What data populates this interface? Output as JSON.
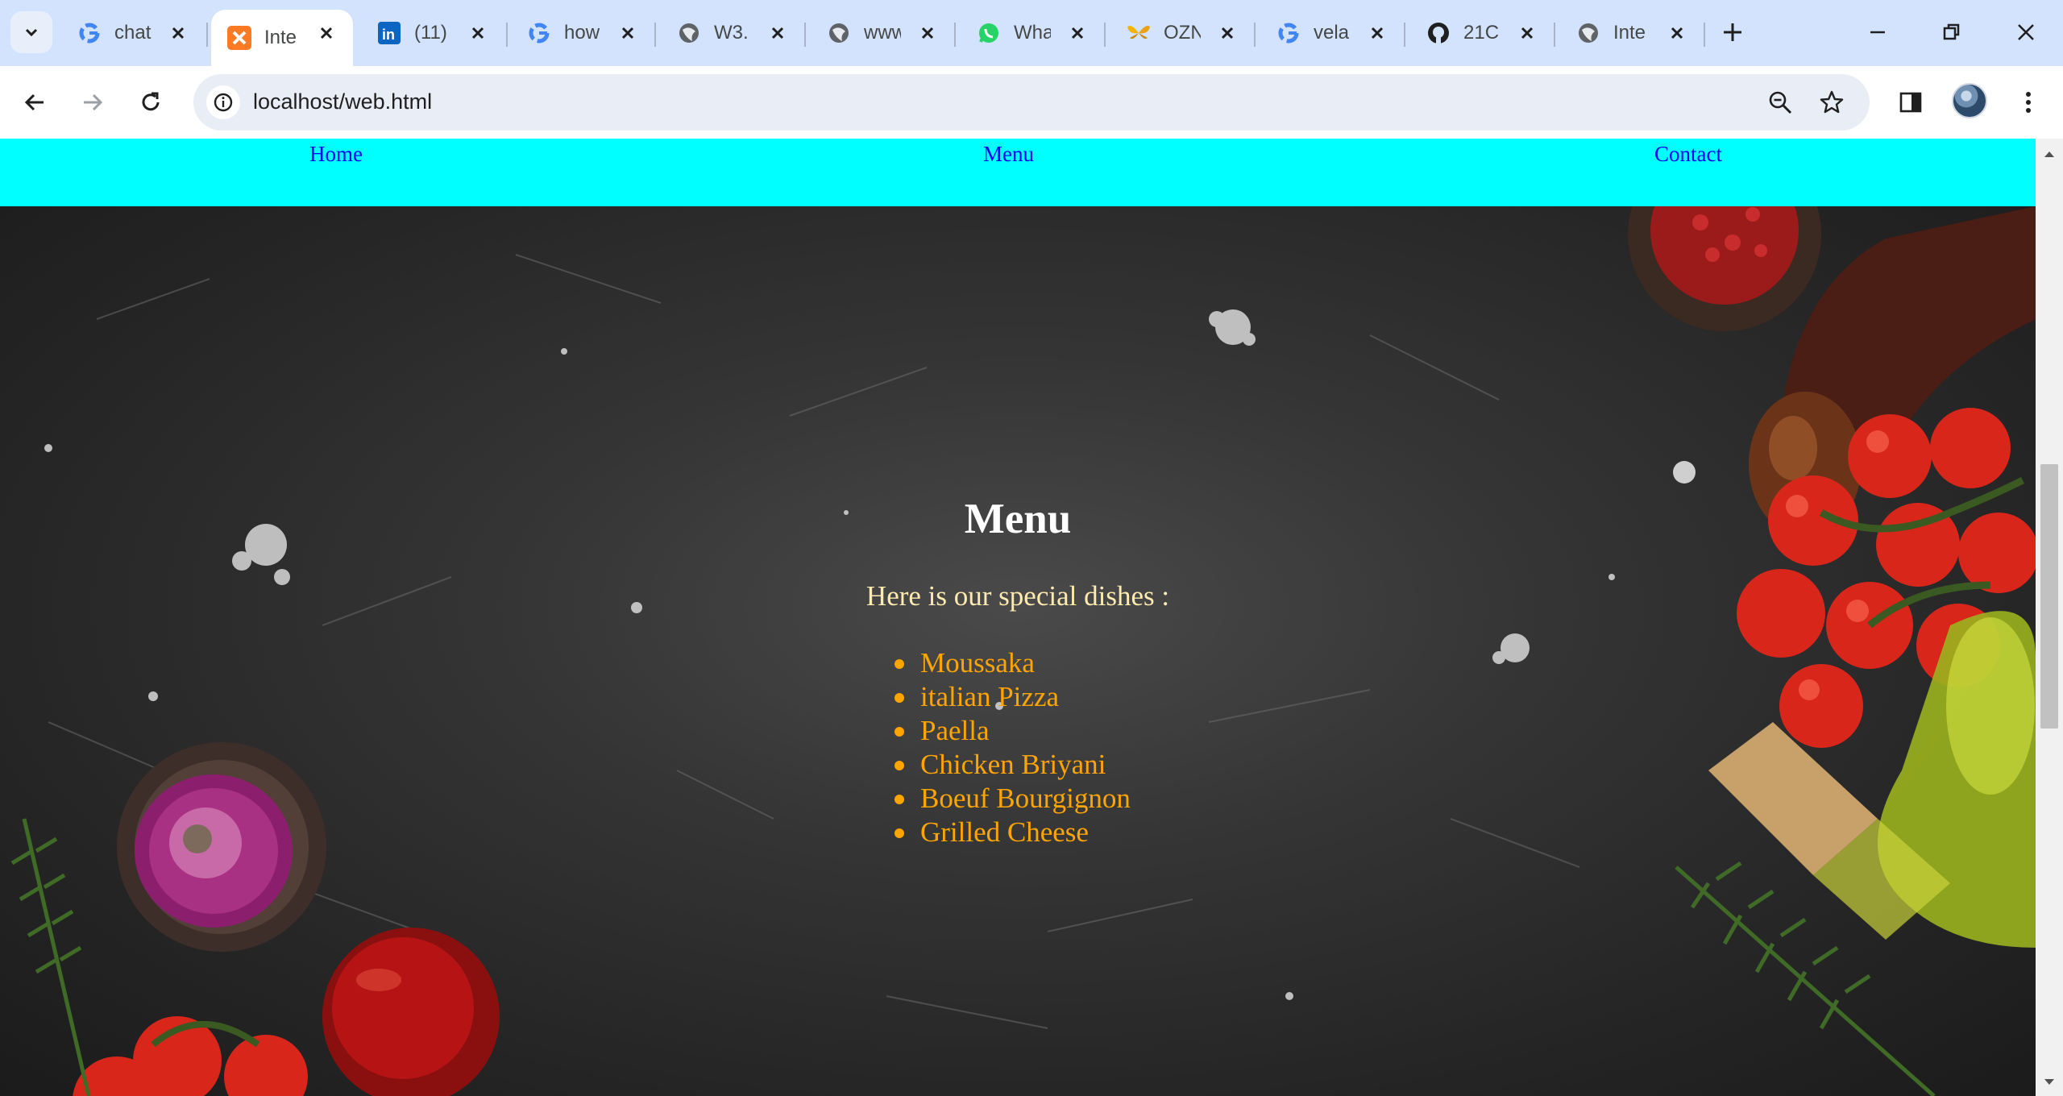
{
  "browser": {
    "tabs": [
      {
        "title": "chat",
        "favicon": "google-icon",
        "active": false
      },
      {
        "title": "Inte",
        "favicon": "xampp-icon",
        "active": true
      },
      {
        "title": "(11)",
        "favicon": "linkedin-icon",
        "active": false
      },
      {
        "title": "how",
        "favicon": "google-icon",
        "active": false
      },
      {
        "title": "W3.",
        "favicon": "globe-icon",
        "active": false
      },
      {
        "title": "www",
        "favicon": "globe-icon",
        "active": false
      },
      {
        "title": "Wha",
        "favicon": "whatsapp-icon",
        "active": false
      },
      {
        "title": "OZN",
        "favicon": "butterfly-icon",
        "active": false
      },
      {
        "title": "vela",
        "favicon": "google-icon",
        "active": false
      },
      {
        "title": "21C",
        "favicon": "github-icon",
        "active": false
      },
      {
        "title": "Inte",
        "favicon": "globe-icon",
        "active": false
      }
    ],
    "url": "localhost/web.html"
  },
  "page": {
    "nav": {
      "home": "Home",
      "menu": "Menu",
      "contact": "Contact"
    },
    "menu_title": "Menu",
    "intro": "Here is our special dishes :",
    "dishes": [
      "Moussaka",
      "italian Pizza",
      "Paella",
      "Chicken Briyani",
      "Boeuf Bourgignon",
      "Grilled Cheese"
    ]
  },
  "colors": {
    "navbar_bg": "#00ffff",
    "nav_link": "#0000ee",
    "title": "#ffffff",
    "intro": "#ffeab0",
    "dishes": "#ffa500"
  }
}
